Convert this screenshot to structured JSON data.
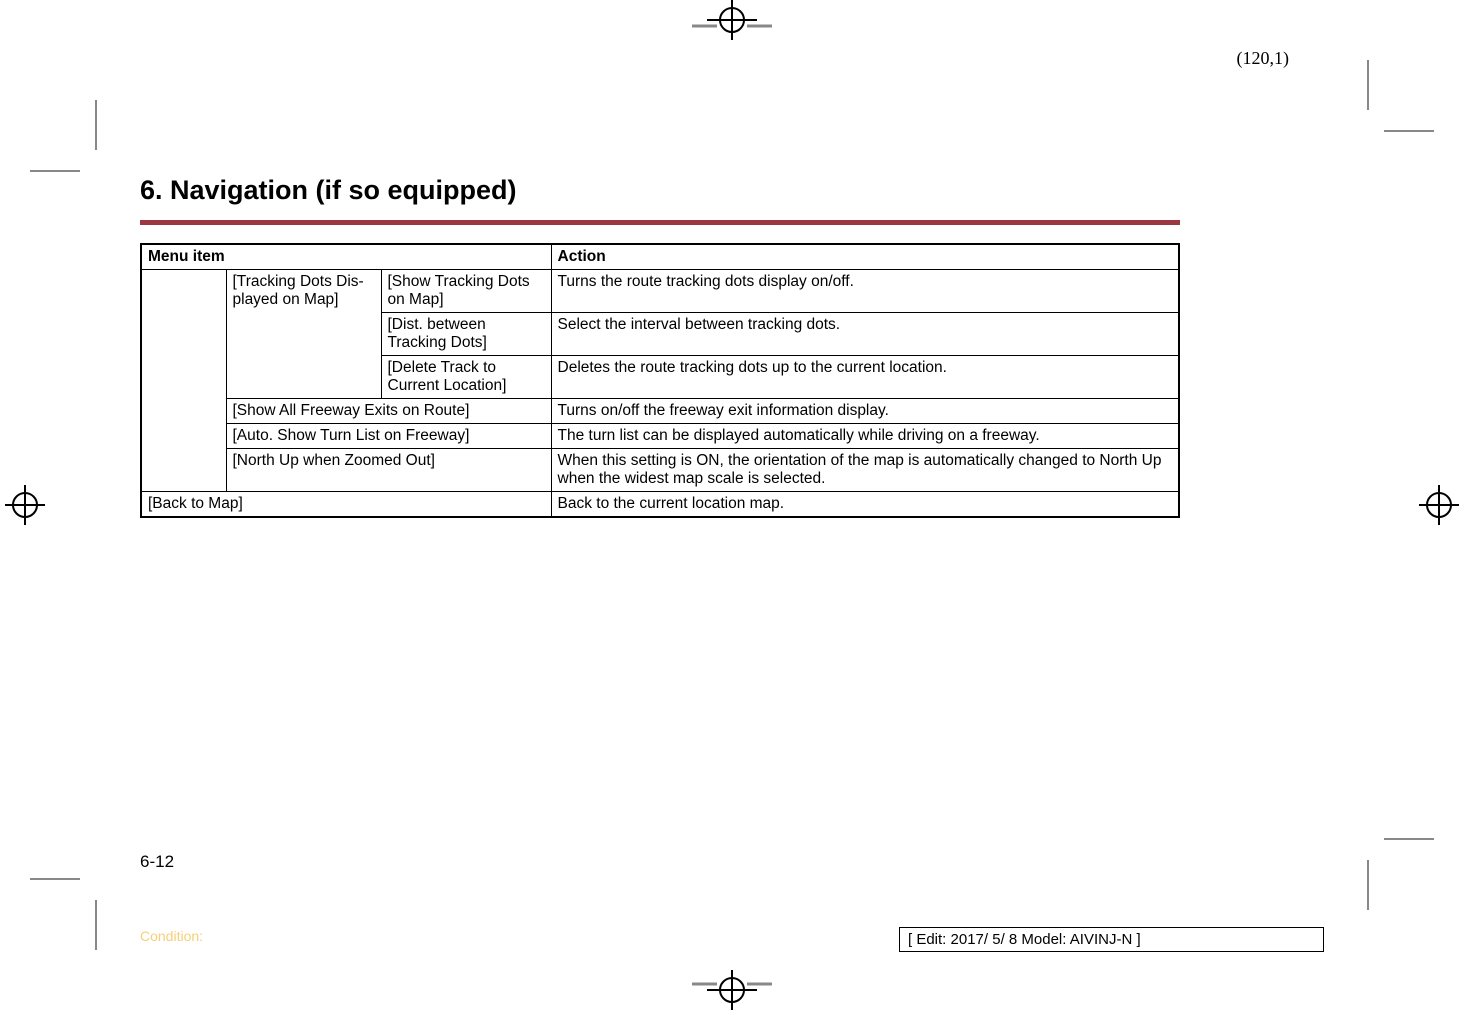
{
  "header_coord": "(120,1)",
  "section_title": "6. Navigation (if so equipped)",
  "table": {
    "header": {
      "menu": "Menu item",
      "action": "Action"
    },
    "rows": [
      {
        "sub1": "[Tracking Dots Dis-played on Map]",
        "sub2": "[Show Tracking Dots on Map]",
        "action": "Turns the route tracking dots display on/off."
      },
      {
        "sub2": "[Dist. between Tracking Dots]",
        "action": "Select the interval between tracking dots."
      },
      {
        "sub2": "[Delete Track to Current Location]",
        "action": "Deletes the route tracking dots up to the current location."
      },
      {
        "sub12": "[Show All Freeway Exits on Route]",
        "action": "Turns on/off the freeway exit information display."
      },
      {
        "sub12": "[Auto. Show Turn List on Freeway]",
        "action": "The turn list can be displayed automatically while driving on a freeway."
      },
      {
        "sub12": "[North Up when Zoomed Out]",
        "action": "When this setting is ON, the orientation of the map is automatically changed to North Up when the widest map scale is selected."
      },
      {
        "full": "[Back to Map]",
        "action": "Back to the current location map."
      }
    ]
  },
  "page_number": "6-12",
  "condition_label": "Condition:",
  "edit_info": "[ Edit: 2017/ 5/ 8   Model: AIVINJ-N ]"
}
